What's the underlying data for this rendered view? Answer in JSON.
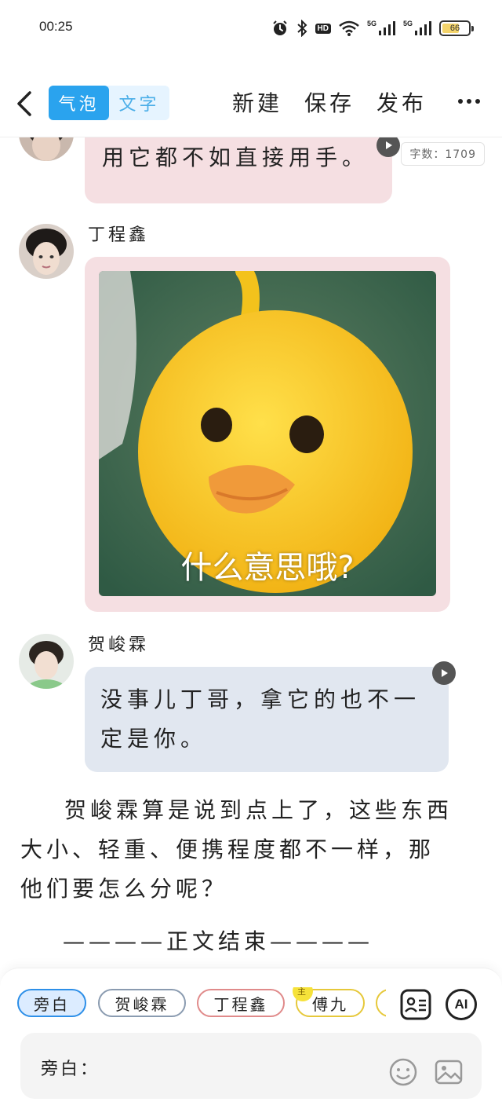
{
  "status_bar": {
    "time": "00:25",
    "hd_label": "HD",
    "net1_label": "5G",
    "net2_label": "5G",
    "battery": {
      "level_percent": 66,
      "label": "66",
      "fill_color": "#f4d46b"
    }
  },
  "toolbar": {
    "mode_options": [
      "气泡",
      "文字"
    ],
    "active_mode": "气泡",
    "new_label": "新建",
    "save_label": "保存",
    "publish_label": "发布",
    "accent_color": "#2aa3ee"
  },
  "word_count": "字数：1709",
  "messages": [
    {
      "text": "用它都不如直接用手。",
      "bubble_color": "#f5dfe2",
      "has_voice": true
    },
    {
      "speaker": "丁程鑫",
      "type": "image",
      "image_caption": "什么意思哦?",
      "bubble_color": "#f5dfe2"
    },
    {
      "speaker": "贺峻霖",
      "text": "没事儿丁哥，拿它的也不一定是你。",
      "text_line1": "没事儿丁哥，拿它的也不一",
      "text_line2": "定是你。",
      "bubble_color": "#e1e7f0",
      "has_voice": true
    }
  ],
  "narration": "贺峻霖算是说到点上了，这些东西大小、轻重、便携程度都不一样，那他们要怎么分呢？",
  "ending_marker": "————正文结束————",
  "bottom": {
    "chips": [
      {
        "label": "旁白",
        "selected": true,
        "border_color": "#2d8fe8"
      },
      {
        "label": "贺峻霖",
        "selected": false,
        "border_color": "#8a9bb0"
      },
      {
        "label": "丁程鑫",
        "selected": false,
        "border_color": "#e08a8a"
      },
      {
        "label": "傅九",
        "selected": false,
        "border_color": "#e6c83a",
        "badge": "主"
      },
      {
        "label": "",
        "selected": false,
        "border_color": "#e6c83a"
      }
    ],
    "ai_label": "AI",
    "input_label": "旁白：",
    "input_value": ""
  }
}
